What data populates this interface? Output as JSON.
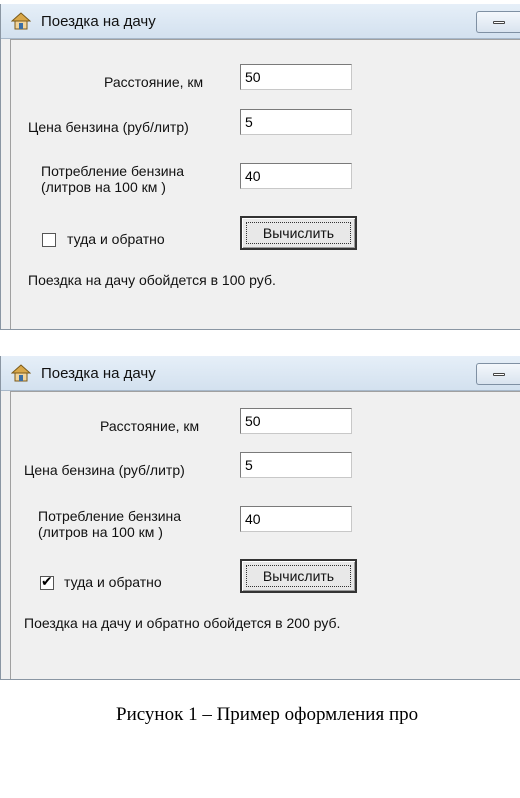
{
  "windows": [
    {
      "title": "Поездка на дачу",
      "labels": {
        "distance": "Расстояние, км",
        "price": "Цена бензина (руб/литр)",
        "consumption": "Потребление бензина (литров на 100 км )"
      },
      "fields": {
        "distance": "50",
        "price": "5",
        "consumption": "40"
      },
      "roundtrip": {
        "label": "туда и обратно",
        "checked": false
      },
      "compute_button": "Вычислить",
      "result": "Поездка на дачу  обойдется в 100 руб."
    },
    {
      "title": "Поездка на дачу",
      "labels": {
        "distance": "Расстояние, км",
        "price": "Цена бензина (руб/литр)",
        "consumption": "Потребление бензина (литров на 100 км )"
      },
      "fields": {
        "distance": "50",
        "price": "5",
        "consumption": "40"
      },
      "roundtrip": {
        "label": "туда и обратно",
        "checked": true
      },
      "compute_button": "Вычислить",
      "result": "Поездка на дачу  и обратно  обойдется в 200 руб."
    }
  ],
  "caption": "Рисунок 1 – Пример оформления про",
  "icons": {
    "title_icon": "house-icon",
    "minimize": "minimize-icon",
    "check": "checkmark-icon"
  }
}
